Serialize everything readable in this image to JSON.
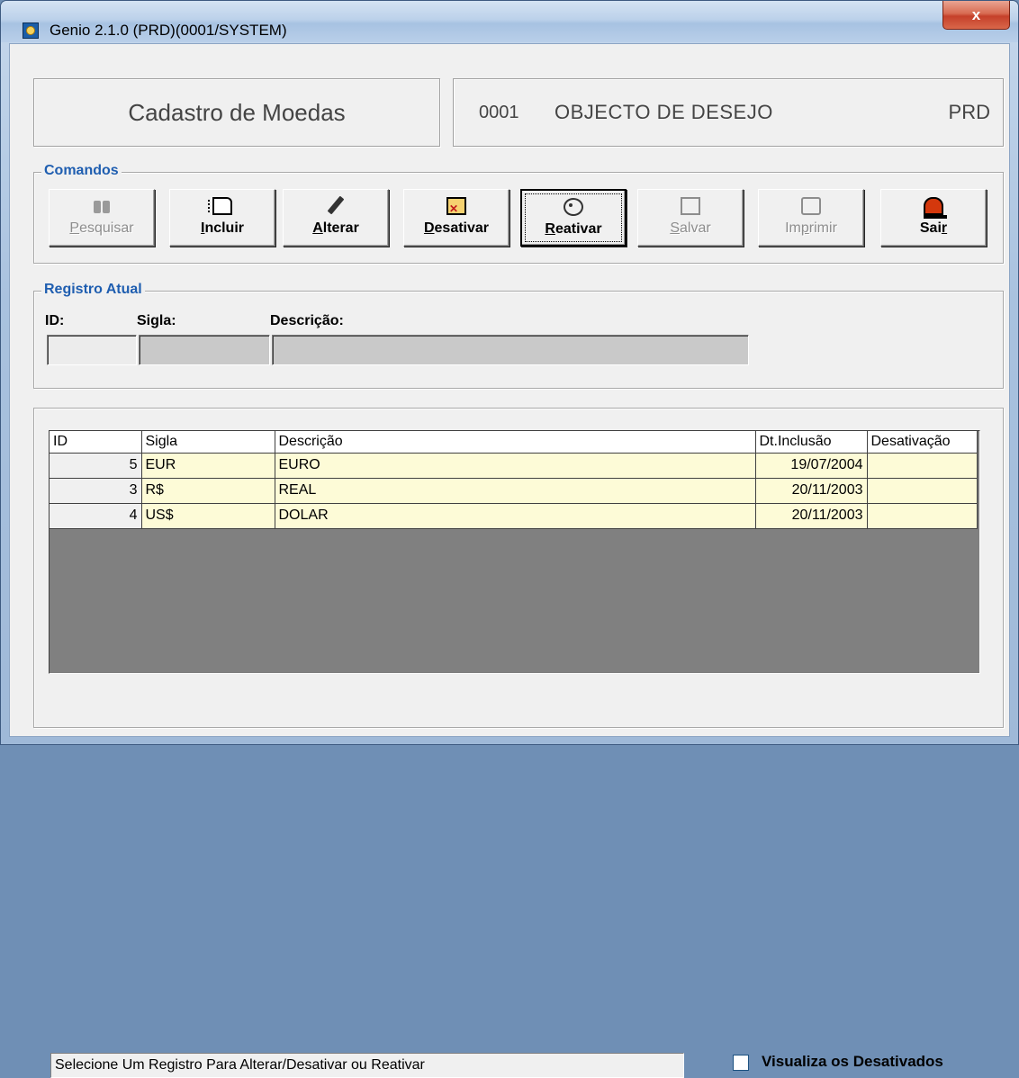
{
  "window": {
    "title": "Genio 2.1.0 (PRD)(0001/SYSTEM)",
    "close_label": "x"
  },
  "header": {
    "screen_title": "Cadastro de Moedas",
    "company_code": "0001",
    "company_name": "OBJECTO DE DESEJO",
    "environment": "PRD"
  },
  "commands": {
    "group_label": "Comandos",
    "buttons": [
      {
        "label_first": "P",
        "label_rest": "esquisar",
        "icon": "binoculars-icon",
        "enabled": false
      },
      {
        "label_first": "I",
        "label_rest": "ncluir",
        "icon": "new-document-icon",
        "enabled": true
      },
      {
        "label_first": "A",
        "label_rest": "lterar",
        "icon": "pencil-icon",
        "enabled": true
      },
      {
        "label_first": "D",
        "label_rest": "esativar",
        "icon": "deactivate-icon",
        "enabled": true
      },
      {
        "label_first": "R",
        "label_rest": "eativar",
        "icon": "reactivate-icon",
        "enabled": true,
        "focused": true
      },
      {
        "label_first": "S",
        "label_rest": "alvar",
        "icon": "save-icon",
        "enabled": false
      },
      {
        "label_pre": "Im",
        "label_first": "p",
        "label_rest": "rimir",
        "icon": "print-icon",
        "enabled": false
      },
      {
        "label_pre": "Sai",
        "label_first": "r",
        "label_rest": "",
        "icon": "exit-icon",
        "enabled": true
      }
    ]
  },
  "current_record": {
    "group_label": "Registro Atual",
    "id_label": "ID:",
    "sigla_label": "Sigla:",
    "descricao_label": "Descrição:",
    "id_value": "",
    "sigla_value": "",
    "descricao_value": ""
  },
  "grid": {
    "columns": [
      "ID",
      "Sigla",
      "Descrição",
      "Dt.Inclusão",
      "Desativação"
    ],
    "rows": [
      {
        "id": "5",
        "sigla": "EUR",
        "descricao": "EURO",
        "dt_inclusao": "19/07/2004",
        "desativacao": ""
      },
      {
        "id": "3",
        "sigla": "R$",
        "descricao": "REAL",
        "dt_inclusao": "20/11/2003",
        "desativacao": ""
      },
      {
        "id": "4",
        "sigla": "US$",
        "descricao": "DOLAR",
        "dt_inclusao": "20/11/2003",
        "desativacao": ""
      }
    ]
  },
  "status": {
    "message": "Selecione Um Registro Para Alterar/Desativar ou Reativar",
    "show_deactivated_label": "Visualiza os Desativados",
    "show_deactivated_checked": false
  },
  "colors": {
    "group_label": "#1f5eb0",
    "grid_row_bg": "#fdfbd7",
    "grid_empty_bg": "#808080"
  }
}
